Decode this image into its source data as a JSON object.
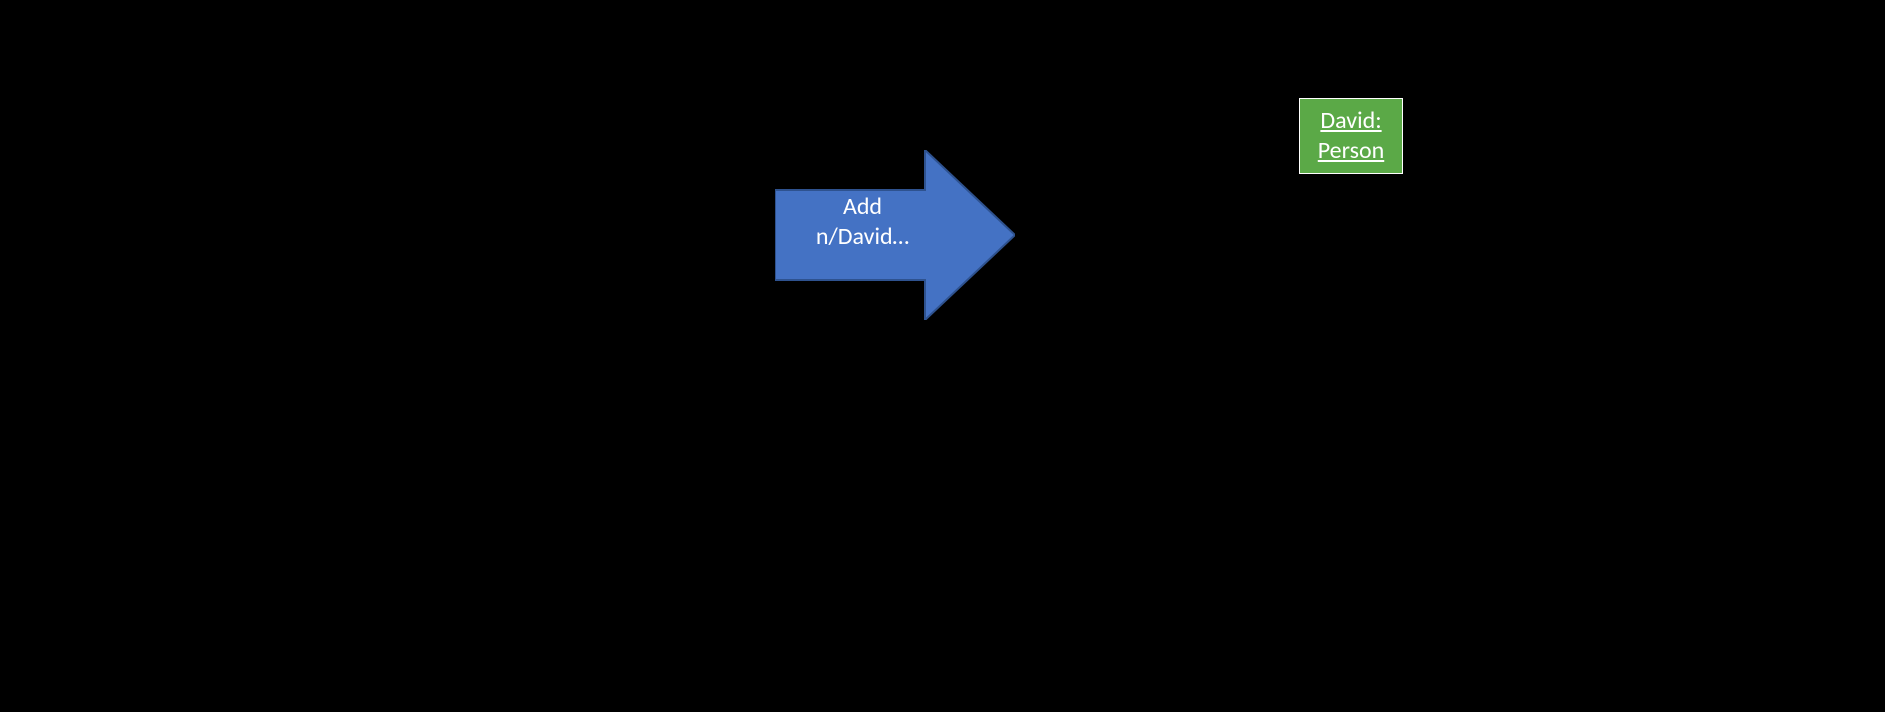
{
  "arrow": {
    "line1": "Add",
    "line2": "n/David…",
    "fill": "#4472C4",
    "stroke": "#2E528F"
  },
  "object": {
    "name": "David:",
    "type": "Person",
    "fill": "#5ba947"
  }
}
